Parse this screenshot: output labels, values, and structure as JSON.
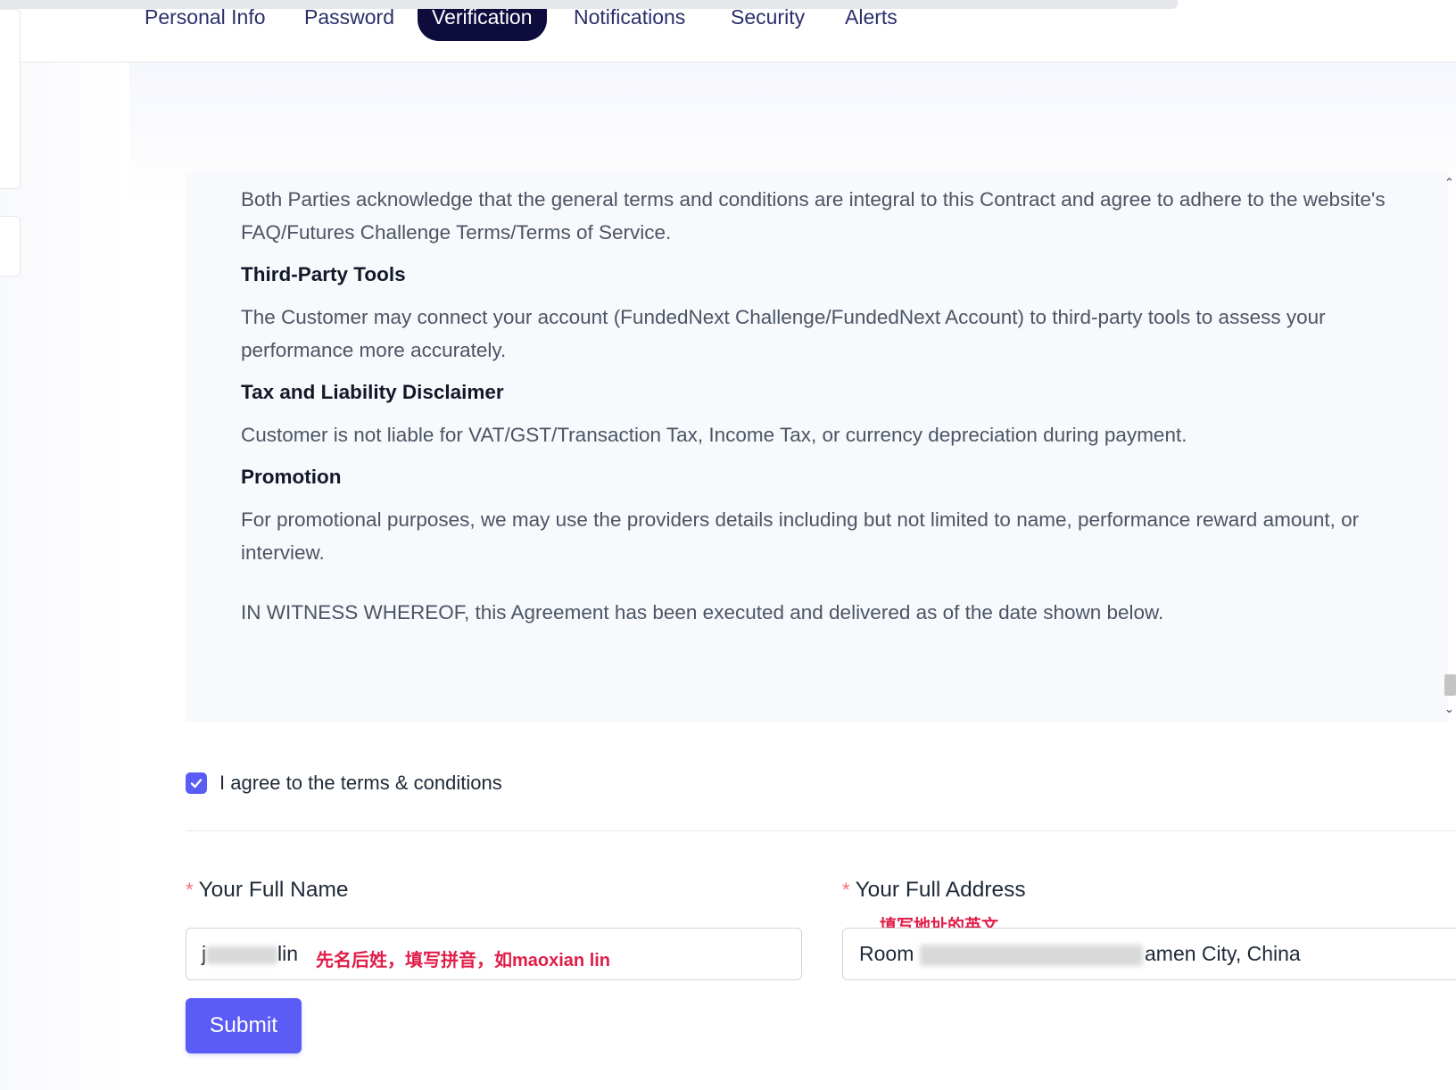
{
  "tabs": [
    {
      "label": "Personal Info"
    },
    {
      "label": "Password"
    },
    {
      "label": "Verification",
      "active": true
    },
    {
      "label": "Notifications"
    },
    {
      "label": "Security"
    },
    {
      "label": "Alerts"
    }
  ],
  "terms": {
    "intro": "Both Parties acknowledge that the general terms and conditions are integral to this Contract and agree to adhere to the website's FAQ/Futures Challenge Terms/Terms of Service.",
    "sections": [
      {
        "heading": "Third-Party Tools",
        "text": "The Customer may connect your account (FundedNext Challenge/FundedNext Account) to third-party tools to assess your performance more accurately."
      },
      {
        "heading": "Tax and Liability Disclaimer",
        "text": "Customer is not liable for VAT/GST/Transaction Tax, Income Tax, or currency depreciation during payment."
      },
      {
        "heading": "Promotion",
        "text": "For promotional purposes, we may use the providers details including but not limited to name, performance reward amount, or interview."
      }
    ],
    "closing": "IN WITNESS WHEREOF, this Agreement has been executed and delivered as of the date shown below."
  },
  "agree": {
    "label": "I agree to the terms & conditions",
    "checked": true
  },
  "form": {
    "name": {
      "required_mark": "*",
      "label": "Your Full Name",
      "value_start": "j",
      "value_end": "lin",
      "note": "先名后姓，填写拼音，如maoxian lin"
    },
    "address": {
      "required_mark": "*",
      "label": "Your Full Address",
      "note": "填写地址的英文",
      "value_start": "Room",
      "value_end": "amen City, China"
    },
    "submit_label": "Submit"
  },
  "colors": {
    "accent": "#5b5bf5",
    "active_tab": "#0e0b3d",
    "note_red": "#e11d48",
    "required": "#f87171"
  },
  "icons": {
    "checkbox": "check-icon",
    "scroll_up": "chevron-up-icon",
    "scroll_down": "chevron-down-icon"
  }
}
